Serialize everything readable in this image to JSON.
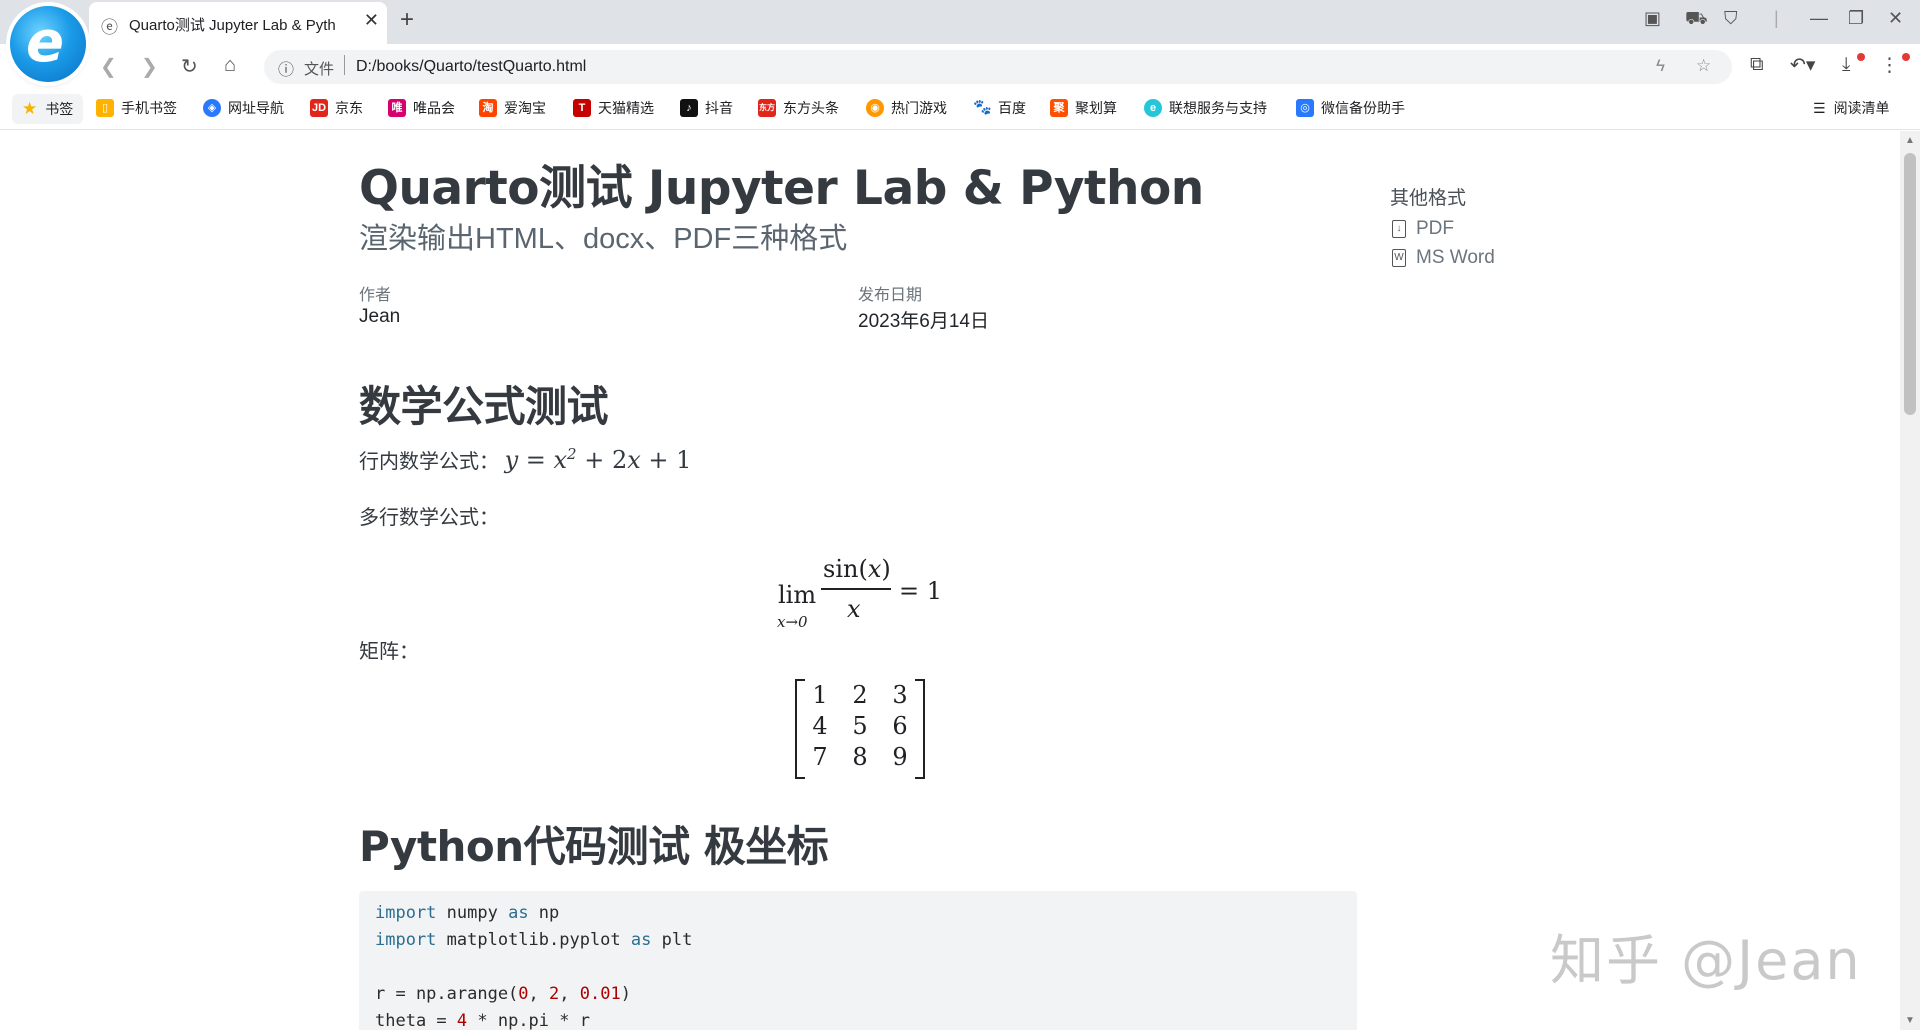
{
  "browser": {
    "tab_title": "Quarto测试 Jupyter Lab & Pyth",
    "url_scheme_label": "文件",
    "url": "D:/books/Quarto/testQuarto.html"
  },
  "bookmarks": {
    "items": [
      "书签",
      "手机书签",
      "网址导航",
      "京东",
      "唯品会",
      "爱淘宝",
      "天猫精选",
      "抖音",
      "东方头条",
      "热门游戏",
      "百度",
      "聚划算",
      "联想服务与支持",
      "微信备份助手"
    ],
    "reading_list": "阅读清单"
  },
  "doc": {
    "title": "Quarto测试 Jupyter Lab & Python",
    "subtitle": "渲染输出HTML、docx、PDF三种格式",
    "author_label": "作者",
    "author": "Jean",
    "date_label": "发布日期",
    "date": "2023年6月14日"
  },
  "other_formats": {
    "title": "其他格式",
    "links": [
      "PDF",
      "MS Word"
    ]
  },
  "sections": {
    "math_heading": "数学公式测试",
    "inline_label": "行内数学公式：",
    "multiline_label": "多行数学公式：",
    "matrix_label": "矩阵：",
    "matrix": [
      [
        "1",
        "2",
        "3"
      ],
      [
        "4",
        "5",
        "6"
      ],
      [
        "7",
        "8",
        "9"
      ]
    ],
    "python_heading": "Python代码测试 极坐标"
  },
  "code": {
    "lines": [
      "import numpy as np",
      "import matplotlib.pyplot as plt",
      "",
      "r = np.arange(0, 2, 0.01)",
      "theta = 4 * np.pi * r"
    ]
  },
  "watermark": "知乎 @Jean"
}
